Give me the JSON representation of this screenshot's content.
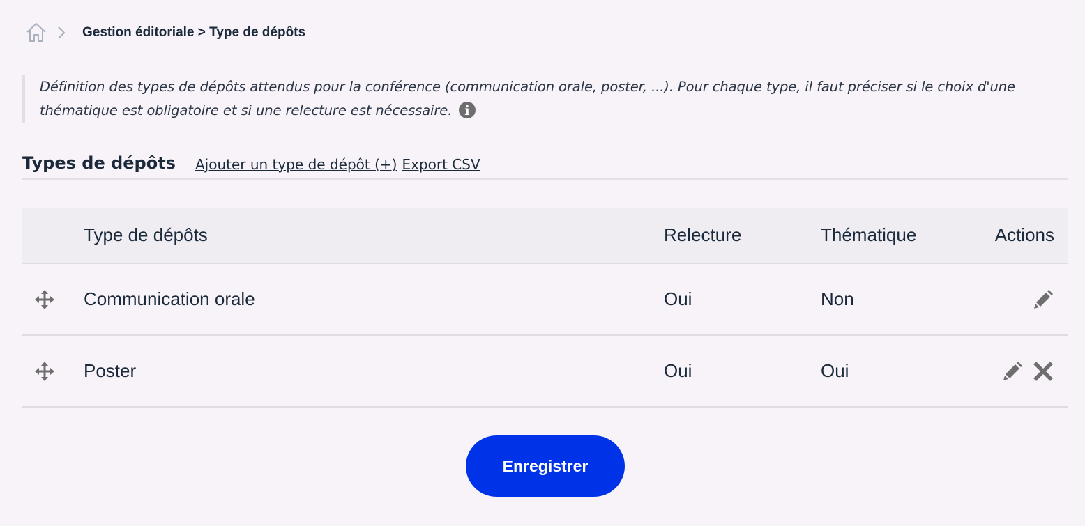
{
  "breadcrumb": {
    "path": "Gestion éditoriale > Type de dépôts"
  },
  "description": {
    "text": "Définition des types de dépôts attendus pour la conférence (communication orale, poster, ...). Pour chaque type, il faut préciser si le choix d'une thématique est obligatoire et si une relecture est nécessaire."
  },
  "section": {
    "title": "Types de dépôts",
    "add_link": "Ajouter un type de dépôt (+)",
    "export_link": "Export CSV"
  },
  "table": {
    "headers": {
      "type": "Type de dépôts",
      "relecture": "Relecture",
      "thematique": "Thématique",
      "actions": "Actions"
    },
    "rows": [
      {
        "type": "Communication orale",
        "relecture": "Oui",
        "thematique": "Non",
        "actions": [
          "edit-icon"
        ]
      },
      {
        "type": "Poster",
        "relecture": "Oui",
        "thematique": "Oui",
        "actions": [
          "edit-icon",
          "delete-icon"
        ]
      }
    ]
  },
  "save_button": {
    "label": "Enregistrer"
  },
  "colors": {
    "background": "#f8f3f8",
    "primary_button": "#0033e8",
    "table_header": "#efecf2",
    "text": "#1b2a3a",
    "icon_gray": "#6e6e6e"
  },
  "icons": {
    "home": "home-icon",
    "chevron": "chevron-right-icon",
    "info": "info-icon",
    "move": "move-icon",
    "edit": "edit-icon",
    "delete": "delete-icon"
  }
}
